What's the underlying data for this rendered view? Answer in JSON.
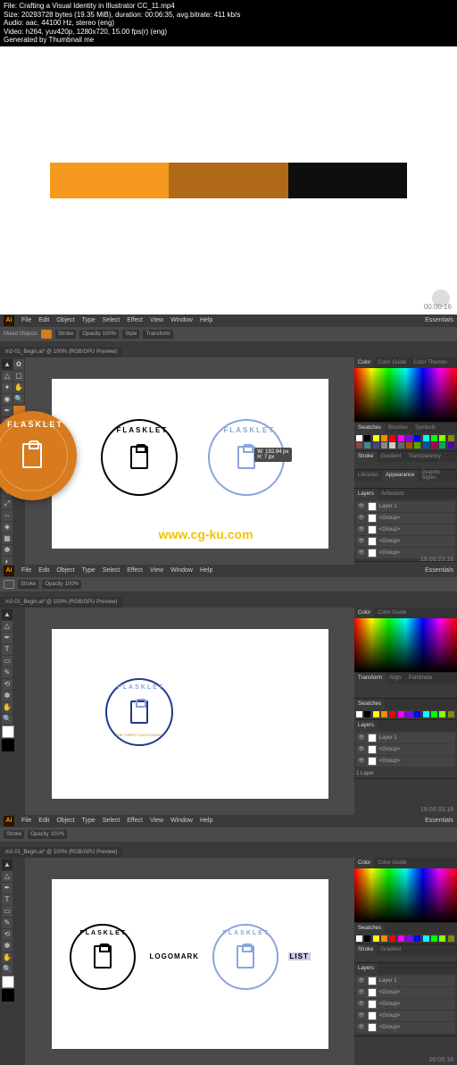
{
  "meta": {
    "l1": "File: Crafting a Visual Identity in Illustrator CC_11.mp4",
    "l2": "Size: 20293728 bytes (19.35 MiB), duration: 00:06:35, avg.bitrate: 411 kb/s",
    "l3": "Audio: aac, 44100 Hz, stereo (eng)",
    "l4": "Video: h264, yuv420p, 1280x720, 15.00 fps(r) (eng)",
    "l5": "Generated by Thumbnail me"
  },
  "palette": {
    "c1": "#f59a1f",
    "c2": "#b06a17",
    "c3": "#0e0e0e"
  },
  "top_timestamp": "00:00:16",
  "menus": [
    "File",
    "Edit",
    "Object",
    "Type",
    "Select",
    "Effect",
    "View",
    "Window",
    "Help"
  ],
  "toolbar": {
    "mode_label": "Mixed Objects",
    "fields": [
      "Stroke",
      "Opacity",
      "100%",
      "Style",
      "Transform"
    ]
  },
  "tab_title": "m2-01_Begin.ai* @ 100% (RGB/GPU Preview)",
  "workspace_label": "Essentials",
  "panels": {
    "color_tabs": [
      "Color",
      "Color Guide",
      "Color Themes"
    ],
    "swatch_tabs": [
      "Swatches",
      "Brushes",
      "Symbols"
    ],
    "stroke_tabs": [
      "Stroke",
      "Gradient",
      "Transparency"
    ],
    "appear_tabs": [
      "Libraries",
      "Appearance",
      "Graphic Styles"
    ],
    "layer_tabs": [
      "Layers",
      "Artboards"
    ],
    "transform_tabs": [
      "Transform",
      "Align",
      "Pathfinder"
    ]
  },
  "layers": {
    "top": "Layer 1",
    "items": [
      "<Group>",
      "<Group>",
      "<Group>",
      "<Group>",
      "<Group>"
    ],
    "count": "1 Layer"
  },
  "logo": {
    "brand": "FLASKLET",
    "tag": "THE THIRSTY DICTIONARY",
    "mark_label": "LOGOMARK",
    "list_label": "LIST"
  },
  "dim_tip": {
    "w": "W: 192.94 px",
    "h": "H: 7 px"
  },
  "watermark": "www.cg-ku.com",
  "timestamps": {
    "s1": "19:00:23:16",
    "s2": "19:00:33:18",
    "s3": "00:05:18"
  }
}
